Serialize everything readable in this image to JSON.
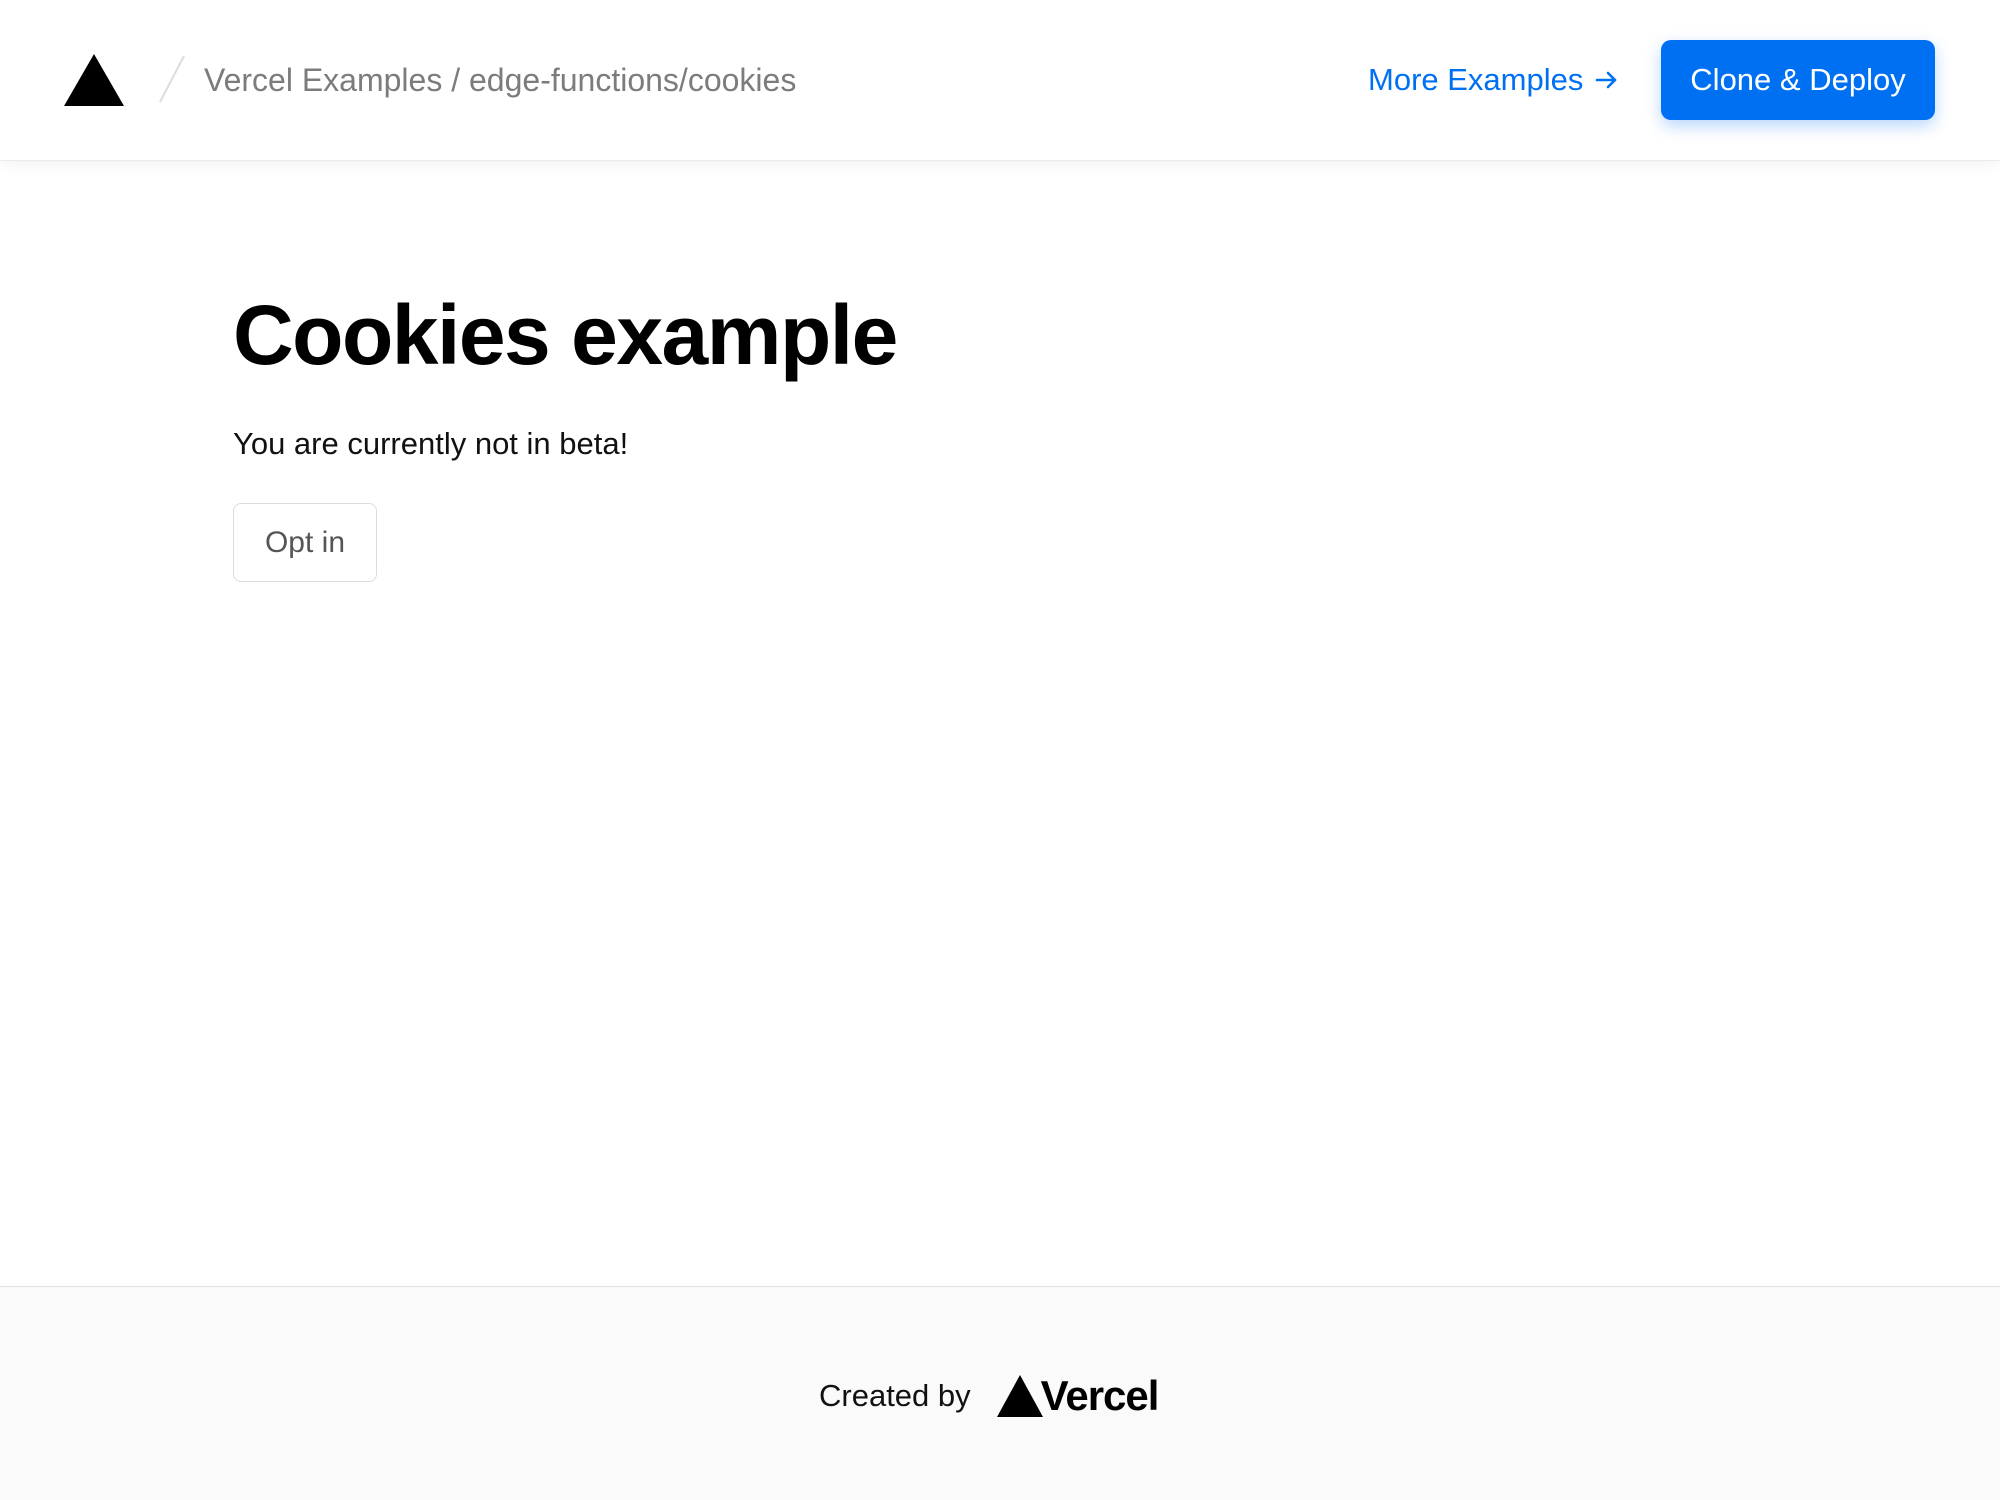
{
  "header": {
    "logo_icon": "vercel-triangle-icon",
    "divider_icon": "slash-divider-icon",
    "breadcrumb": "Vercel Examples / edge-functions/cookies",
    "more_examples_label": "More Examples",
    "more_examples_icon": "arrow-right-icon",
    "deploy_label": "Clone & Deploy"
  },
  "main": {
    "title": "Cookies example",
    "status_text": "You are currently not in beta!",
    "opt_in_label": "Opt in"
  },
  "footer": {
    "created_by": "Created by",
    "brand_icon": "vercel-triangle-icon",
    "brand_name": "Vercel"
  },
  "colors": {
    "accent": "#0070f3",
    "text": "#111111",
    "muted": "#7c7c7c",
    "footer_bg": "#fafafa"
  }
}
